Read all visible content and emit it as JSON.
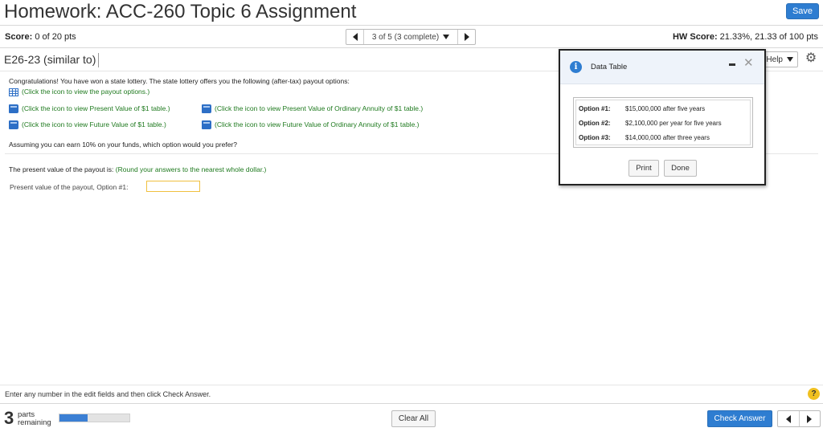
{
  "header": {
    "title": "Homework: ACC-260 Topic 6 Assignment",
    "save_label": "Save"
  },
  "score_bar": {
    "score_label": "Score:",
    "score_value": "0 of 20 pts",
    "nav_text": "3 of 5 (3 complete)",
    "hw_score_label": "HW Score:",
    "hw_score_value": "21.33%, 21.33 of 100 pts"
  },
  "question_bar": {
    "question_id": "E26-23 (similar to)",
    "help_label": "Help"
  },
  "question": {
    "intro": "Congratulations! You have won a state lottery. The state lottery offers you the following (after-tax) payout options:",
    "payout_link": "(Click the icon to view the payout options.)",
    "pv_link": "(Click the icon to view Present Value of $1 table.)",
    "pv_annuity_link": "(Click the icon to view Present Value of Ordinary Annuity of $1 table.)",
    "fv_link": "(Click the icon to view Future Value of $1 table.)",
    "fv_annuity_link": "(Click the icon to view Future Value of Ordinary Annuity of $1 table.)",
    "prompt": "Assuming you can earn 10% on your funds, which option would you prefer?",
    "instruction_lead": "The present value of the payout is:",
    "instruction_note": "(Round your answers to the nearest whole dollar.)",
    "answer_label": "Present value of the payout, Option #1:",
    "answer_value": ""
  },
  "footer": {
    "hint": "Enter any number in the edit fields and then click Check Answer.",
    "help_symbol": "?",
    "parts_count": "3",
    "parts_line1": "parts",
    "parts_line2": "remaining",
    "progress_fraction": 0.4,
    "clear_label": "Clear All",
    "check_label": "Check Answer"
  },
  "data_table": {
    "title": "Data Table",
    "info_symbol": "i",
    "options": [
      {
        "label": "Option #1:",
        "value": "$15,000,000 after five years"
      },
      {
        "label": "Option #2:",
        "value": "$2,100,000 per year for five years"
      },
      {
        "label": "Option #3:",
        "value": "$14,000,000 after three years"
      }
    ],
    "print_label": "Print",
    "done_label": "Done"
  },
  "colors": {
    "accent_blue": "#2e7dd1",
    "link_green": "#1f7a1f",
    "input_border": "#f0c040",
    "help_yellow": "#f0c020"
  },
  "icons": [
    "grid-icon",
    "book-icon",
    "info-icon",
    "gear-icon",
    "close-icon",
    "minimize-icon",
    "chevron-down-icon",
    "arrow-left-icon",
    "arrow-right-icon",
    "question-icon"
  ]
}
